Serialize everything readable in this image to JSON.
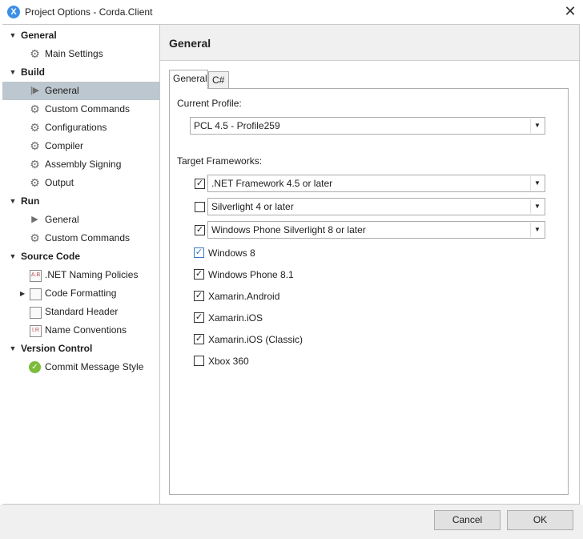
{
  "window": {
    "title": "Project Options - Corda.Client",
    "app_icon": "X",
    "close_glyph": "✕"
  },
  "sidebar": {
    "categories": [
      {
        "label": "General",
        "items": [
          {
            "label": "Main Settings",
            "icon": "gear-icon"
          }
        ]
      },
      {
        "label": "Build",
        "items": [
          {
            "label": "General",
            "icon": "play-icon",
            "selected": true
          },
          {
            "label": "Custom Commands",
            "icon": "gear-icon"
          },
          {
            "label": "Configurations",
            "icon": "gear-icon"
          },
          {
            "label": "Compiler",
            "icon": "gear-icon"
          },
          {
            "label": "Assembly Signing",
            "icon": "gear-icon"
          },
          {
            "label": "Output",
            "icon": "gear-icon"
          }
        ]
      },
      {
        "label": "Run",
        "items": [
          {
            "label": "General",
            "icon": "play-icon"
          },
          {
            "label": "Custom Commands",
            "icon": "gear-icon"
          }
        ]
      },
      {
        "label": "Source Code",
        "items": [
          {
            "label": ".NET Naming Policies",
            "icon": "naming-doc-icon",
            "icon_text": "A.B"
          },
          {
            "label": "Code Formatting",
            "icon": "document-icon",
            "collapsed": true
          },
          {
            "label": "Standard Header",
            "icon": "document-icon"
          },
          {
            "label": "Name Conventions",
            "icon": "naming-doc-icon",
            "icon_text": "I.R"
          }
        ]
      },
      {
        "label": "Version Control",
        "items": [
          {
            "label": "Commit Message Style",
            "icon": "check-circle-icon"
          }
        ]
      }
    ]
  },
  "main": {
    "header_title": "General",
    "tabs": [
      {
        "label": "General",
        "active": true
      },
      {
        "label": "C#",
        "active": false
      }
    ],
    "current_profile_label": "Current Profile:",
    "current_profile_value": "PCL 4.5 - Profile259",
    "target_frameworks_label": "Target Frameworks:",
    "framework_combos": [
      {
        "label": ".NET Framework 4.5 or later",
        "checked": true
      },
      {
        "label": "Silverlight 4 or later",
        "checked": false
      },
      {
        "label": "Windows Phone Silverlight 8 or later",
        "checked": true
      }
    ],
    "framework_checks": [
      {
        "label": "Windows 8",
        "checked": true,
        "focused": true
      },
      {
        "label": "Windows Phone 8.1",
        "checked": true
      },
      {
        "label": "Xamarin.Android",
        "checked": true
      },
      {
        "label": "Xamarin.iOS",
        "checked": true
      },
      {
        "label": "Xamarin.iOS (Classic)",
        "checked": true
      },
      {
        "label": "Xbox 360",
        "checked": false
      }
    ]
  },
  "footer": {
    "cancel_label": "Cancel",
    "ok_label": "OK"
  },
  "colors": {
    "selected_row": "#bcc7cf",
    "header_band": "#f0f0f0",
    "accent": "#3b8ee6"
  }
}
